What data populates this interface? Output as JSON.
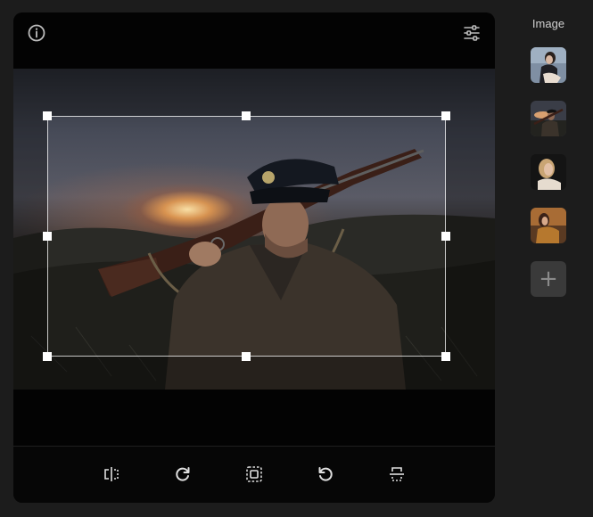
{
  "panel": {
    "title": "Image"
  },
  "top_bar": {
    "left_icon": "info-icon",
    "right_icon": "sliders-icon"
  },
  "toolbar": {
    "tools": [
      {
        "icon": "flip-horizontal-icon"
      },
      {
        "icon": "rotate-clockwise-icon"
      },
      {
        "icon": "crop-fit-icon"
      },
      {
        "icon": "rotate-counterclockwise-icon"
      },
      {
        "icon": "flip-vertical-icon"
      }
    ]
  },
  "thumbnails": [
    {
      "name": "woman-sitting-portrait"
    },
    {
      "name": "soldier-with-rifle"
    },
    {
      "name": "blonde-woman-portrait"
    },
    {
      "name": "woman-golden-dress"
    }
  ],
  "add_button": {
    "label": "+"
  },
  "colors": {
    "background": "#1c1c1c",
    "editor_background": "#030303",
    "crop_border": "#ffffff"
  }
}
